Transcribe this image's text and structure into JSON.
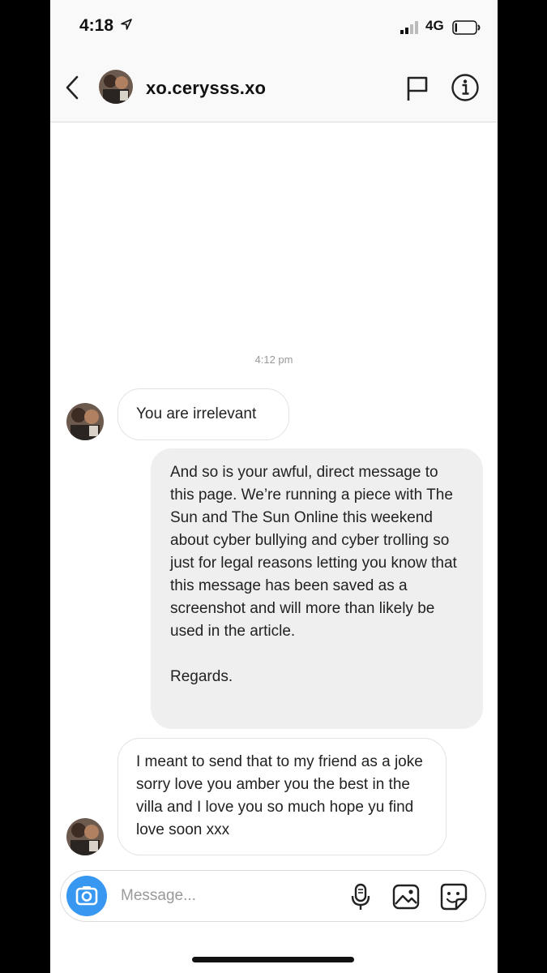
{
  "status_bar": {
    "time": "4:18",
    "network": "4G",
    "icons": [
      "location-arrow-icon",
      "signal-icon",
      "battery-icon"
    ]
  },
  "header": {
    "username": "xo.cerysss.xo",
    "icons": [
      "back-chevron-icon",
      "avatar",
      "flag-icon",
      "info-icon"
    ]
  },
  "chat": {
    "timestamp": "4:12 pm",
    "messages": [
      {
        "side": "incoming",
        "text": "You are irrelevant"
      },
      {
        "side": "outgoing",
        "text": "And so is your awful, direct message to this page. We’re running a piece with The Sun and The Sun Online this weekend about cyber bullying and cyber trolling so just for legal reasons letting you know that this message has been saved as a screenshot and will more than likely be used in the article.",
        "sign_off": "Regards."
      },
      {
        "side": "incoming",
        "text": "I meant to send that to my friend as a joke sorry love you amber you the best in the villa and I love you so much hope yu find love soon xxx"
      }
    ]
  },
  "composer": {
    "placeholder": "Message...",
    "value": "",
    "icons": [
      "camera-icon",
      "microphone-icon",
      "gallery-icon",
      "sticker-icon"
    ]
  },
  "colors": {
    "accent_blue": "#3897f0",
    "outgoing_bubble": "#efefef",
    "incoming_border": "#e2e2e2",
    "timestamp_gray": "#999999"
  }
}
